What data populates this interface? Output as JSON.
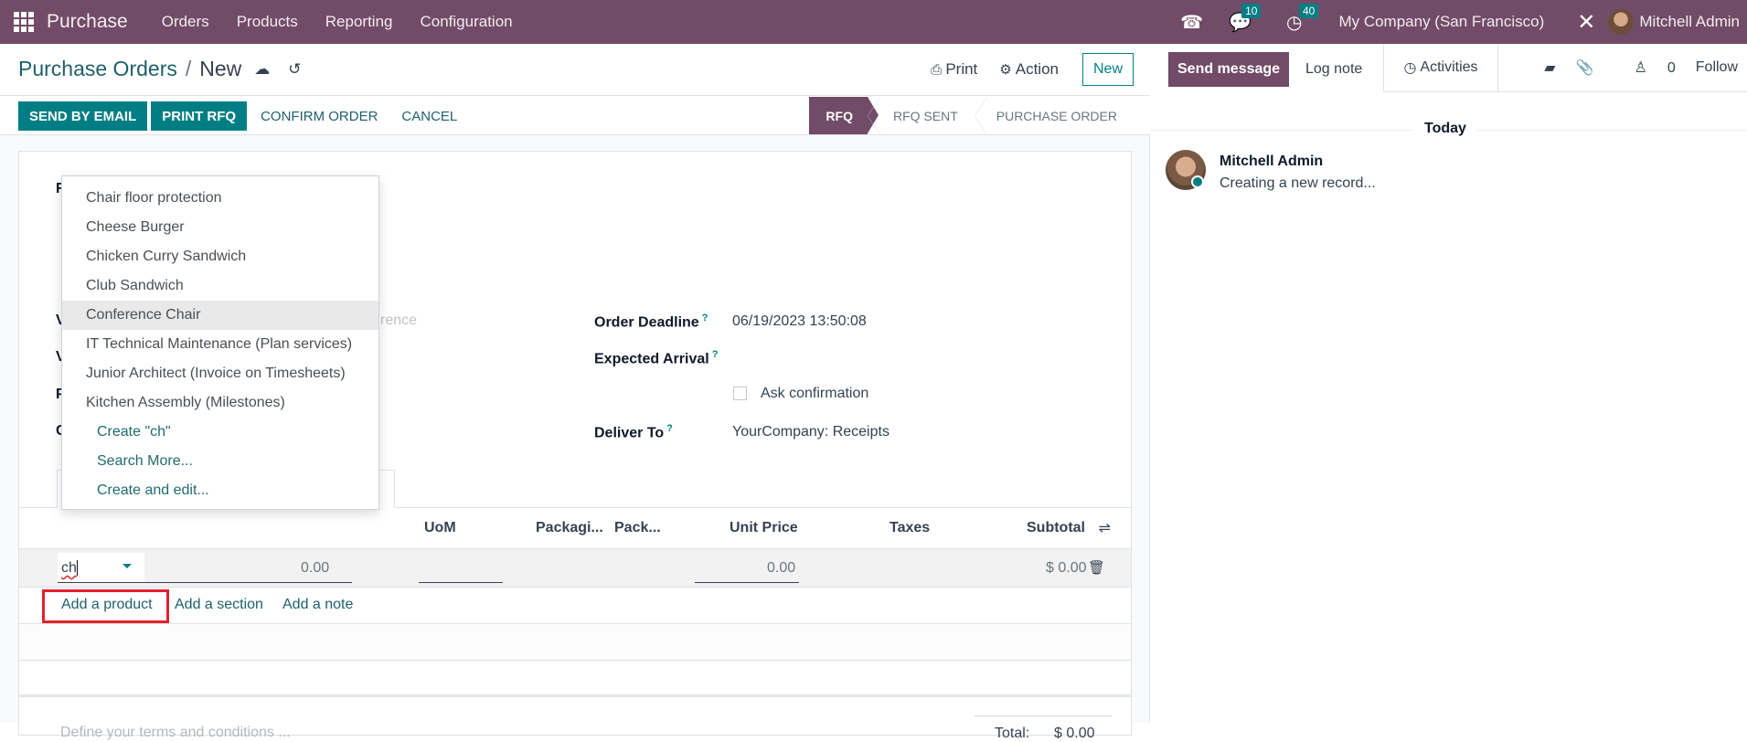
{
  "navbar": {
    "app_name": "Purchase",
    "menu": [
      "Orders",
      "Products",
      "Reporting",
      "Configuration"
    ],
    "messages_badge": "10",
    "activities_badge": "40",
    "company": "My Company (San Francisco)",
    "user": "Mitchell Admin"
  },
  "breadcrumb": {
    "parent": "Purchase Orders",
    "separator": "/",
    "current": "New"
  },
  "control_panel": {
    "print_label": "Print",
    "action_label": "Action",
    "new_label": "New"
  },
  "status_buttons": {
    "send_email": "SEND BY EMAIL",
    "print_rfq": "PRINT RFQ",
    "confirm_order": "CONFIRM ORDER",
    "cancel": "CANCEL"
  },
  "statusbar": {
    "stages": [
      "RFQ",
      "RFQ SENT",
      "PURCHASE ORDER"
    ],
    "active": "RFQ"
  },
  "form": {
    "left_label_stubs": [
      "R",
      "V",
      "V",
      "P",
      "C"
    ],
    "reference_placeholder_fragment": "rence",
    "order_deadline_label": "Order Deadline",
    "order_deadline_value": "06/19/2023 13:50:08",
    "expected_arrival_label": "Expected Arrival",
    "ask_confirmation_label": "Ask confirmation",
    "ask_confirmation_checked": false,
    "deliver_to_label": "Deliver To",
    "deliver_to_value": "YourCompany: Receipts",
    "help_marker": "?"
  },
  "order_lines": {
    "columns": [
      "UoM",
      "Packagi...",
      "Pack...",
      "Unit Price",
      "Taxes",
      "Subtotal"
    ],
    "row": {
      "product_input": "ch",
      "quantity": "0.00",
      "unit_price": "0.00",
      "subtotal": "$ 0.00"
    },
    "add_product": "Add a product",
    "add_section": "Add a section",
    "add_note": "Add a note"
  },
  "autocomplete": {
    "items": [
      "Chair floor protection",
      "Cheese Burger",
      "Chicken Curry Sandwich",
      "Club Sandwich",
      "Conference Chair",
      "IT Technical Maintenance (Plan services)",
      "Junior Architect (Invoice on Timesheets)",
      "Kitchen Assembly (Milestones)"
    ],
    "highlighted": "Conference Chair",
    "actions": [
      "Create \"ch\"",
      "Search More...",
      "Create and edit..."
    ]
  },
  "footer": {
    "terms_placeholder": "Define your terms and conditions ...",
    "total_label": "Total:",
    "total_value": "$ 0.00"
  },
  "chatter": {
    "send_message": "Send message",
    "log_note": "Log note",
    "activities": "Activities",
    "followers_count": "0",
    "follow": "Follow",
    "date_separator": "Today",
    "message": {
      "author": "Mitchell Admin",
      "body": "Creating a new record..."
    }
  },
  "colors": {
    "brand": "#714b67",
    "primary": "#017e84",
    "highlight_box": "#e3202c"
  }
}
